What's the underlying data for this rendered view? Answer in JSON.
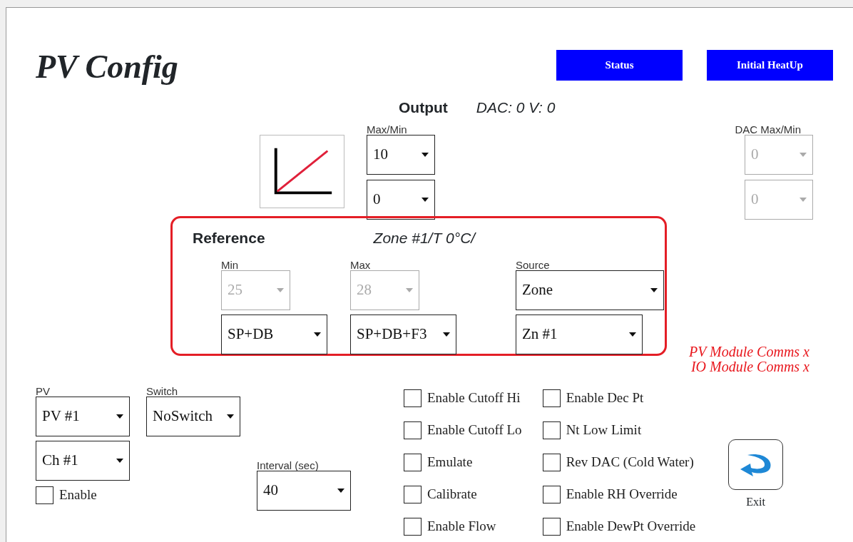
{
  "title": "PV Config",
  "header_buttons": [
    "Status",
    "Initial HeatUp"
  ],
  "output": {
    "label": "Output",
    "reading": "DAC: 0 V: 0",
    "max_min": {
      "label": "Max/Min",
      "selects": [
        {
          "value": "10",
          "disabled": false
        },
        {
          "value": "0",
          "disabled": false
        }
      ]
    },
    "dac_max_min": {
      "label": "DAC Max/Min",
      "selects": [
        {
          "value": "0",
          "disabled": true
        },
        {
          "value": "0",
          "disabled": true
        }
      ]
    }
  },
  "reference": {
    "label": "Reference",
    "reading": "Zone #1/T 0°C/",
    "columns": [
      {
        "label": "Min",
        "selects": [
          {
            "value": "25",
            "disabled": true
          },
          {
            "value": "SP+DB",
            "disabled": false
          }
        ]
      },
      {
        "label": "Max",
        "selects": [
          {
            "value": "28",
            "disabled": true
          },
          {
            "value": "SP+DB+F3",
            "disabled": false
          }
        ]
      },
      {
        "label": "Source",
        "selects": [
          {
            "value": "Zone",
            "disabled": false
          },
          {
            "value": "Zn #1",
            "disabled": false
          }
        ]
      }
    ]
  },
  "comms": [
    "PV Module Comms x",
    "IO Module Comms x"
  ],
  "pv": {
    "label": "PV",
    "selects": [
      {
        "value": "PV #1",
        "disabled": false
      },
      {
        "value": "Ch #1",
        "disabled": false
      }
    ],
    "enable": {
      "label": "Enable",
      "checked": false
    }
  },
  "switch": {
    "label": "Switch",
    "selects": [
      {
        "value": "NoSwitch",
        "disabled": false
      }
    ]
  },
  "interval": {
    "label": "Interval (sec)",
    "selects": [
      {
        "value": "40",
        "disabled": false
      }
    ]
  },
  "options": [
    [
      {
        "label": "Enable Cutoff Hi",
        "checked": false
      },
      {
        "label": "Enable Cutoff Lo",
        "checked": false
      },
      {
        "label": "Emulate",
        "checked": false
      },
      {
        "label": "Calibrate",
        "checked": false
      },
      {
        "label": "Enable Flow",
        "checked": false
      }
    ],
    [
      {
        "label": "Enable Dec Pt",
        "checked": false
      },
      {
        "label": "Nt Low Limit",
        "checked": false
      },
      {
        "label": "Rev DAC (Cold Water)",
        "checked": false
      },
      {
        "label": "Enable RH Override",
        "checked": false
      },
      {
        "label": "Enable DewPt Override",
        "checked": false
      }
    ]
  ],
  "exit": {
    "label": "Exit"
  }
}
